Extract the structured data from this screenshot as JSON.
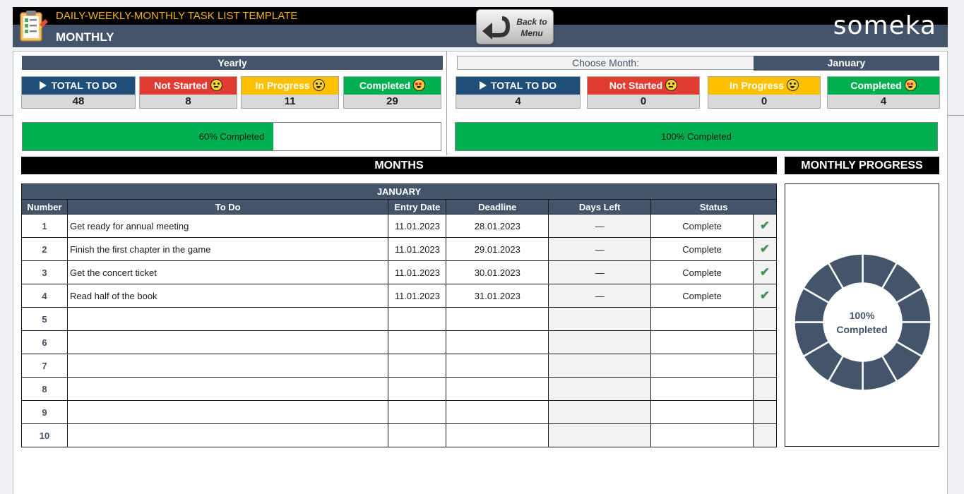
{
  "header": {
    "title": "DAILY-WEEKLY-MONTHLY TASK LIST TEMPLATE",
    "subtitle": "MONTHLY",
    "back_line1": "Back to",
    "back_line2": "Menu",
    "brand": "someka"
  },
  "yearly": {
    "band": "Yearly",
    "total_label": "TOTAL TO DO",
    "total": "48",
    "not_started_label": "Not Started",
    "not_started": "8",
    "in_progress_label": "In Progress",
    "in_progress": "11",
    "completed_label": "Completed",
    "completed": "29",
    "progress_text": "60% Completed",
    "progress_fraction": 0.6
  },
  "monthly": {
    "choose_label": "Choose Month:",
    "selected_month": "January",
    "total_label": "TOTAL TO DO",
    "total": "4",
    "not_started_label": "Not Started",
    "not_started": "0",
    "in_progress_label": "In Progress",
    "in_progress": "0",
    "completed_label": "Completed",
    "completed": "4",
    "progress_text": "100% Completed",
    "progress_fraction": 1.0
  },
  "sections": {
    "months": "MONTHS",
    "monthly_progress": "MONTHLY PROGRESS"
  },
  "table": {
    "month_title": "JANUARY",
    "columns": [
      "Number",
      "To Do",
      "Entry Date",
      "Deadline",
      "Days Left",
      "Status"
    ],
    "rows": [
      {
        "number": "1",
        "todo": "Get ready for annual meeting",
        "entry": "11.01.2023",
        "deadline": "28.01.2023",
        "days_left": "—",
        "status": "Complete",
        "check": "✔"
      },
      {
        "number": "2",
        "todo": "Finish the first chapter in the game",
        "entry": "11.01.2023",
        "deadline": "29.01.2023",
        "days_left": "—",
        "status": "Complete",
        "check": "✔"
      },
      {
        "number": "3",
        "todo": "Get the concert ticket",
        "entry": "11.01.2023",
        "deadline": "30.01.2023",
        "days_left": "—",
        "status": "Complete",
        "check": "✔"
      },
      {
        "number": "4",
        "todo": "Read half of the book",
        "entry": "11.01.2023",
        "deadline": "31.01.2023",
        "days_left": "—",
        "status": "Complete",
        "check": "✔"
      },
      {
        "number": "5",
        "todo": "",
        "entry": "",
        "deadline": "",
        "days_left": "",
        "status": "",
        "check": ""
      },
      {
        "number": "6",
        "todo": "",
        "entry": "",
        "deadline": "",
        "days_left": "",
        "status": "",
        "check": ""
      },
      {
        "number": "7",
        "todo": "",
        "entry": "",
        "deadline": "",
        "days_left": "",
        "status": "",
        "check": ""
      },
      {
        "number": "8",
        "todo": "",
        "entry": "",
        "deadline": "",
        "days_left": "",
        "status": "",
        "check": ""
      },
      {
        "number": "9",
        "todo": "",
        "entry": "",
        "deadline": "",
        "days_left": "",
        "status": "",
        "check": ""
      },
      {
        "number": "10",
        "todo": "",
        "entry": "",
        "deadline": "",
        "days_left": "",
        "status": "",
        "check": ""
      }
    ]
  },
  "donut": {
    "percent_text": "100%",
    "completed_text": "Completed",
    "segments": 12,
    "completed_fraction": 1.0,
    "color": "#44546a"
  },
  "colors": {
    "header_band": "#44546a",
    "total": "#1f4e79",
    "not_started": "#e03c31",
    "in_progress": "#ffc000",
    "completed": "#00b050"
  }
}
